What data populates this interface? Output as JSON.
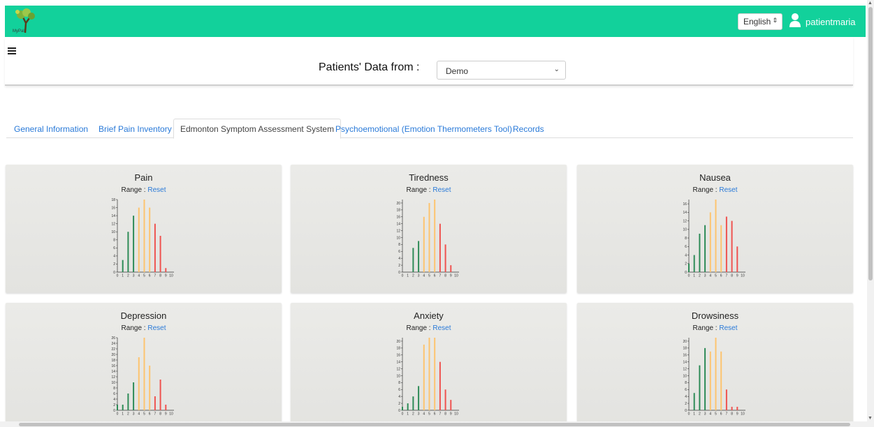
{
  "header": {
    "logo_text": "MyPal",
    "language": "English",
    "username": "patientmaria"
  },
  "source": {
    "label": "Patients' Data from :",
    "selected": "Demo"
  },
  "tabs": [
    {
      "label": "General Information",
      "active": false
    },
    {
      "label": "Brief Pain Inventory",
      "active": false
    },
    {
      "label": "Edmonton Symptom Assessment System",
      "active": true
    },
    {
      "label": "Psychoemotional (Emotion Thermometers Tool)",
      "active": false
    },
    {
      "label": "Records",
      "active": false
    }
  ],
  "range_label": "Range :",
  "reset_label": "Reset",
  "colors": {
    "brand": "#12d19b",
    "low": "#2e8b57",
    "mid": "#fdc46f",
    "high": "#ef5350"
  },
  "chart_data": [
    {
      "type": "bar",
      "title": "Pain",
      "categories": [
        "0",
        "1",
        "2",
        "3",
        "4",
        "5",
        "6",
        "7",
        "8",
        "9",
        "10"
      ],
      "values": [
        0,
        3,
        10,
        14,
        16,
        18,
        16,
        12,
        9,
        1,
        0
      ],
      "yticks": [
        "0",
        "2",
        "4",
        "6",
        "8",
        "10",
        "12",
        "14",
        "16",
        "18"
      ],
      "ylim": [
        0,
        18
      ]
    },
    {
      "type": "bar",
      "title": "Tiredness",
      "categories": [
        "0",
        "1",
        "2",
        "3",
        "4",
        "5",
        "6",
        "7",
        "8",
        "9",
        "10"
      ],
      "values": [
        0,
        0,
        7,
        9,
        16,
        20,
        21,
        14,
        8,
        2,
        0
      ],
      "yticks": [
        "0",
        "2",
        "4",
        "6",
        "8",
        "10",
        "12",
        "14",
        "16",
        "18",
        "20"
      ],
      "ylim": [
        0,
        21
      ]
    },
    {
      "type": "bar",
      "title": "Nausea",
      "categories": [
        "0",
        "1",
        "2",
        "3",
        "4",
        "5",
        "6",
        "7",
        "8",
        "9",
        "10"
      ],
      "values": [
        2,
        4,
        9,
        11,
        14,
        17,
        11,
        13,
        12,
        6,
        0
      ],
      "yticks": [
        "0",
        "2",
        "4",
        "6",
        "8",
        "10",
        "12",
        "14",
        "16"
      ],
      "ylim": [
        0,
        17
      ]
    },
    {
      "type": "bar",
      "title": "Depression",
      "categories": [
        "0",
        "1",
        "2",
        "3",
        "4",
        "5",
        "6",
        "7",
        "8",
        "9",
        "10"
      ],
      "values": [
        2,
        2,
        6,
        10,
        19,
        26,
        16,
        5,
        11,
        2,
        0
      ],
      "yticks": [
        "0",
        "2",
        "4",
        "6",
        "8",
        "10",
        "12",
        "14",
        "16",
        "18",
        "20",
        "22",
        "24",
        "26"
      ],
      "ylim": [
        0,
        26
      ]
    },
    {
      "type": "bar",
      "title": "Anxiety",
      "categories": [
        "0",
        "1",
        "2",
        "3",
        "4",
        "5",
        "6",
        "7",
        "8",
        "9",
        "10"
      ],
      "values": [
        1,
        2,
        4,
        7,
        19,
        21,
        21,
        14,
        6,
        3,
        0
      ],
      "yticks": [
        "0",
        "2",
        "4",
        "6",
        "8",
        "10",
        "12",
        "14",
        "16",
        "18",
        "20"
      ],
      "ylim": [
        0,
        21
      ]
    },
    {
      "type": "bar",
      "title": "Drowsiness",
      "categories": [
        "0",
        "1",
        "2",
        "3",
        "4",
        "5",
        "6",
        "7",
        "8",
        "9",
        "10"
      ],
      "values": [
        0,
        5,
        13,
        18,
        17,
        21,
        17,
        6,
        1,
        1,
        0
      ],
      "yticks": [
        "0",
        "2",
        "4",
        "6",
        "8",
        "10",
        "12",
        "14",
        "16",
        "18",
        "20"
      ],
      "ylim": [
        0,
        21
      ]
    }
  ]
}
